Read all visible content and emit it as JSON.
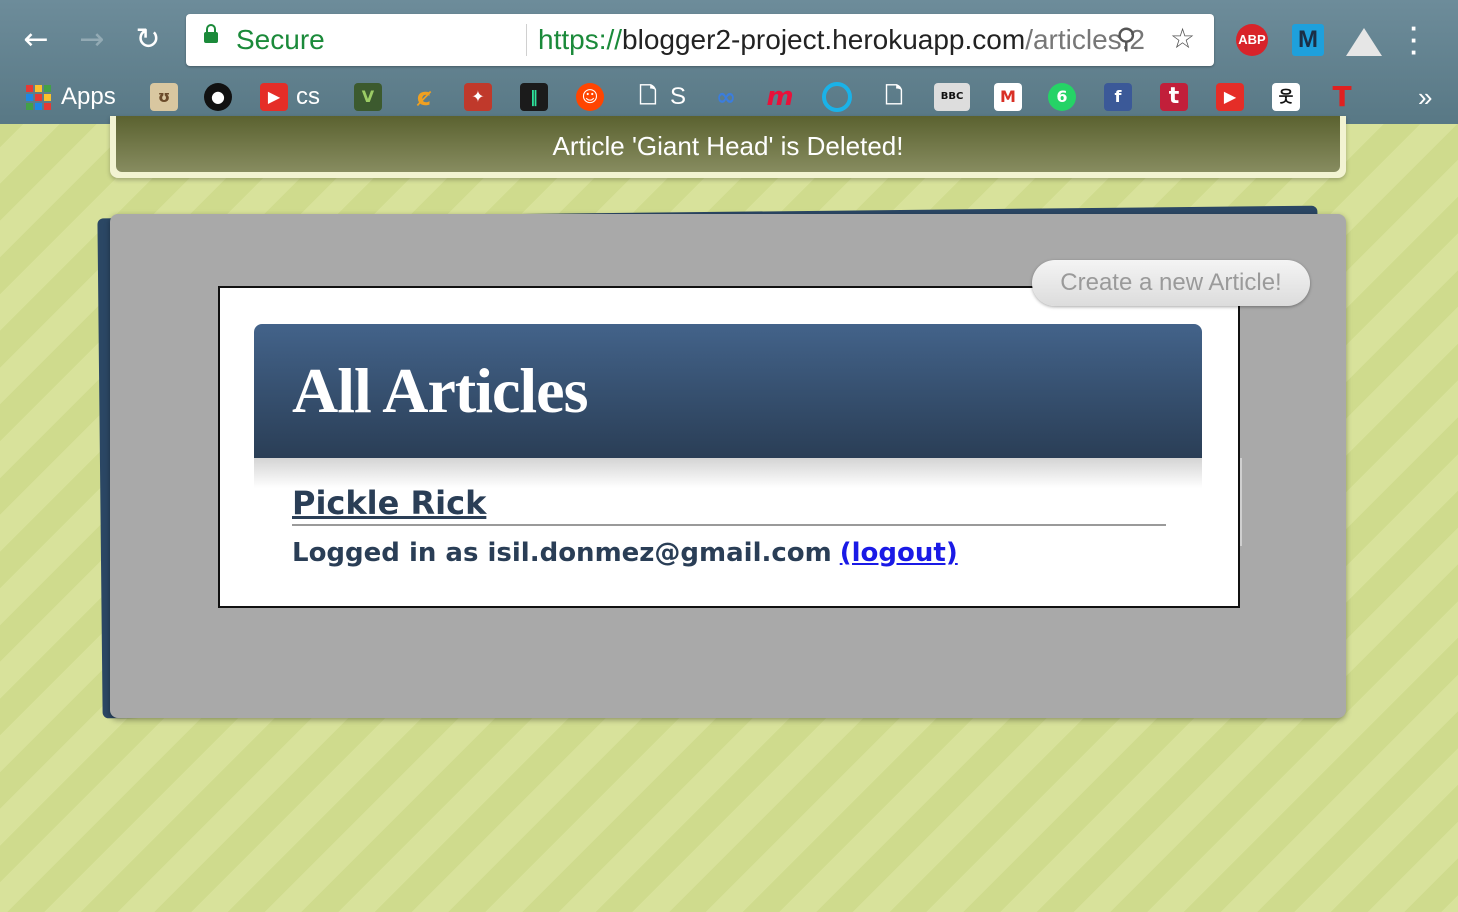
{
  "browser": {
    "secure_label": "Secure",
    "url_scheme": "https://",
    "url_host": "blogger2-project.herokuapp.com",
    "url_path": "/articles.2",
    "extensions": {
      "abp": "ABP",
      "m": "M"
    }
  },
  "bookmarks": {
    "apps_label": "Apps",
    "cs_label": "cs",
    "s_label": "S",
    "bbc_label": "BBC",
    "whatsapp_badge": "6",
    "more": "»"
  },
  "flash": {
    "message": "Article 'Giant Head' is Deleted!"
  },
  "main": {
    "title": "All Articles",
    "create_button": "Create a new Article!",
    "articles": [
      {
        "title": "Pickle Rick"
      }
    ],
    "login_text": "Logged in as isil.donmez@gmail.com",
    "logout_label": "(logout)"
  },
  "colors": {
    "header_top": "#43638a",
    "header_bottom": "#2a3e56",
    "flash_bg": "#5b6230",
    "link_blue": "#1a1ae6",
    "secure_green": "#1b8a3a"
  }
}
